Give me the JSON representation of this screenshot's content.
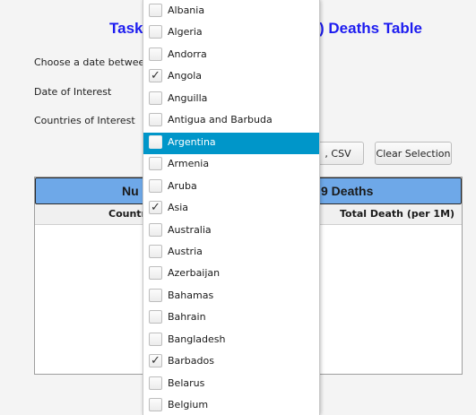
{
  "header": {
    "title_left": "Task",
    "title_right": ") Deaths Table"
  },
  "form": {
    "choose_date_label": "Choose a date between",
    "date_label": "Date of Interest",
    "countries_label": "Countries of Interest"
  },
  "buttons": {
    "csv_label": ", CSV",
    "clear_label": "Clear Selection"
  },
  "table": {
    "header_left": "Nu",
    "header_right": "9 Deaths",
    "col_country": "Countr",
    "col_total": "Total Death (per 1M)"
  },
  "dropdown": {
    "items": [
      {
        "label": "Albania",
        "checked": false,
        "selected": false
      },
      {
        "label": "Algeria",
        "checked": false,
        "selected": false
      },
      {
        "label": "Andorra",
        "checked": false,
        "selected": false
      },
      {
        "label": "Angola",
        "checked": true,
        "selected": false
      },
      {
        "label": "Anguilla",
        "checked": false,
        "selected": false
      },
      {
        "label": "Antigua and Barbuda",
        "checked": false,
        "selected": false
      },
      {
        "label": "Argentina",
        "checked": false,
        "selected": true
      },
      {
        "label": "Armenia",
        "checked": false,
        "selected": false
      },
      {
        "label": "Aruba",
        "checked": false,
        "selected": false
      },
      {
        "label": "Asia",
        "checked": true,
        "selected": false
      },
      {
        "label": "Australia",
        "checked": false,
        "selected": false
      },
      {
        "label": "Austria",
        "checked": false,
        "selected": false
      },
      {
        "label": "Azerbaijan",
        "checked": false,
        "selected": false
      },
      {
        "label": "Bahamas",
        "checked": false,
        "selected": false
      },
      {
        "label": "Bahrain",
        "checked": false,
        "selected": false
      },
      {
        "label": "Bangladesh",
        "checked": false,
        "selected": false
      },
      {
        "label": "Barbados",
        "checked": true,
        "selected": false
      },
      {
        "label": "Belarus",
        "checked": false,
        "selected": false
      },
      {
        "label": "Belgium",
        "checked": false,
        "selected": false
      }
    ],
    "check_glyph": "✓"
  },
  "colors": {
    "title": "#1d1cf0",
    "table_header": "#6ea8e8",
    "selection": "#0096c9"
  }
}
